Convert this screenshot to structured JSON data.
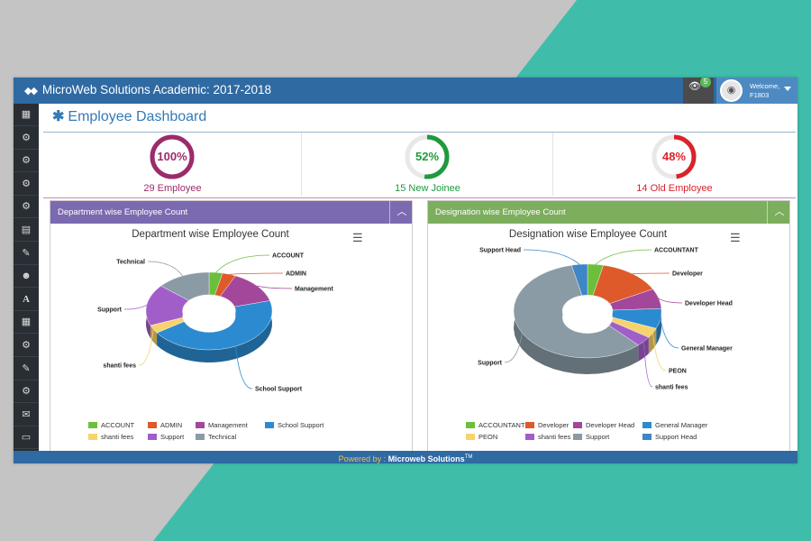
{
  "app": {
    "title": "MicroWeb Solutions Academic: 2017-2018",
    "notification_count": "5",
    "welcome_text": "Welcome,",
    "user_id": "F1803",
    "footer_powered_by": "Powered by :",
    "footer_company": "Microweb Solutions",
    "footer_tm": "TM"
  },
  "sidebar": {
    "items": [
      {
        "icon": "table-icon"
      },
      {
        "icon": "gears-icon"
      },
      {
        "icon": "gears-icon"
      },
      {
        "icon": "gears-icon"
      },
      {
        "icon": "gears-icon"
      },
      {
        "icon": "calendar-icon"
      },
      {
        "icon": "edit-icon"
      },
      {
        "icon": "users-icon"
      },
      {
        "icon": "font-icon"
      },
      {
        "icon": "table-icon"
      },
      {
        "icon": "gears-icon"
      },
      {
        "icon": "edit-icon"
      },
      {
        "icon": "gears-icon"
      },
      {
        "icon": "envelope-icon"
      },
      {
        "icon": "credit-card-icon"
      }
    ]
  },
  "page": {
    "title": "Employee Dashboard"
  },
  "stats": [
    {
      "percent": 100,
      "percent_text": "100%",
      "label": "29 Employee",
      "color": "#9c2b6b"
    },
    {
      "percent": 52,
      "percent_text": "52%",
      "label": "15 New Joinee",
      "color": "#1f9a3e"
    },
    {
      "percent": 48,
      "percent_text": "48%",
      "label": "14 Old Employee",
      "color": "#d9232a"
    }
  ],
  "panels": [
    {
      "header": "Department wise Employee Count",
      "header_color": "#7c6ab0"
    },
    {
      "header": "Designation wise Employee Count",
      "header_color": "#7cae5e"
    }
  ],
  "chart_data": [
    {
      "type": "pie",
      "variant": "3d-donut",
      "title": "Department wise Employee Count",
      "slices": [
        {
          "label": "ACCOUNT",
          "value": 1,
          "color": "#6cbf3a"
        },
        {
          "label": "ADMIN",
          "value": 1,
          "color": "#de5a2b"
        },
        {
          "label": "Management",
          "value": 4,
          "color": "#a3479b"
        },
        {
          "label": "School Support",
          "value": 13,
          "color": "#2c8bd0"
        },
        {
          "label": "shanti fees",
          "value": 1,
          "color": "#f6d36c"
        },
        {
          "label": "Support",
          "value": 5,
          "color": "#a25ec8"
        },
        {
          "label": "Technical",
          "value": 4,
          "color": "#8b9ba5"
        }
      ],
      "legend_position": "bottom"
    },
    {
      "type": "pie",
      "variant": "3d-donut",
      "title": "Designation wise Employee Count",
      "slices": [
        {
          "label": "ACCOUNTANT",
          "value": 1,
          "color": "#6cbf3a"
        },
        {
          "label": "Developer",
          "value": 4,
          "color": "#de5a2b"
        },
        {
          "label": "Developer Head",
          "value": 2,
          "color": "#a3479b"
        },
        {
          "label": "General Manager",
          "value": 2,
          "color": "#2c8bd0"
        },
        {
          "label": "PEON",
          "value": 1,
          "color": "#f6d36c"
        },
        {
          "label": "shanti fees",
          "value": 1,
          "color": "#a25ec8"
        },
        {
          "label": "Support",
          "value": 17,
          "color": "#8b9ba5"
        },
        {
          "label": "Support Head",
          "value": 1,
          "color": "#3f86c6"
        }
      ],
      "legend_position": "bottom"
    }
  ]
}
